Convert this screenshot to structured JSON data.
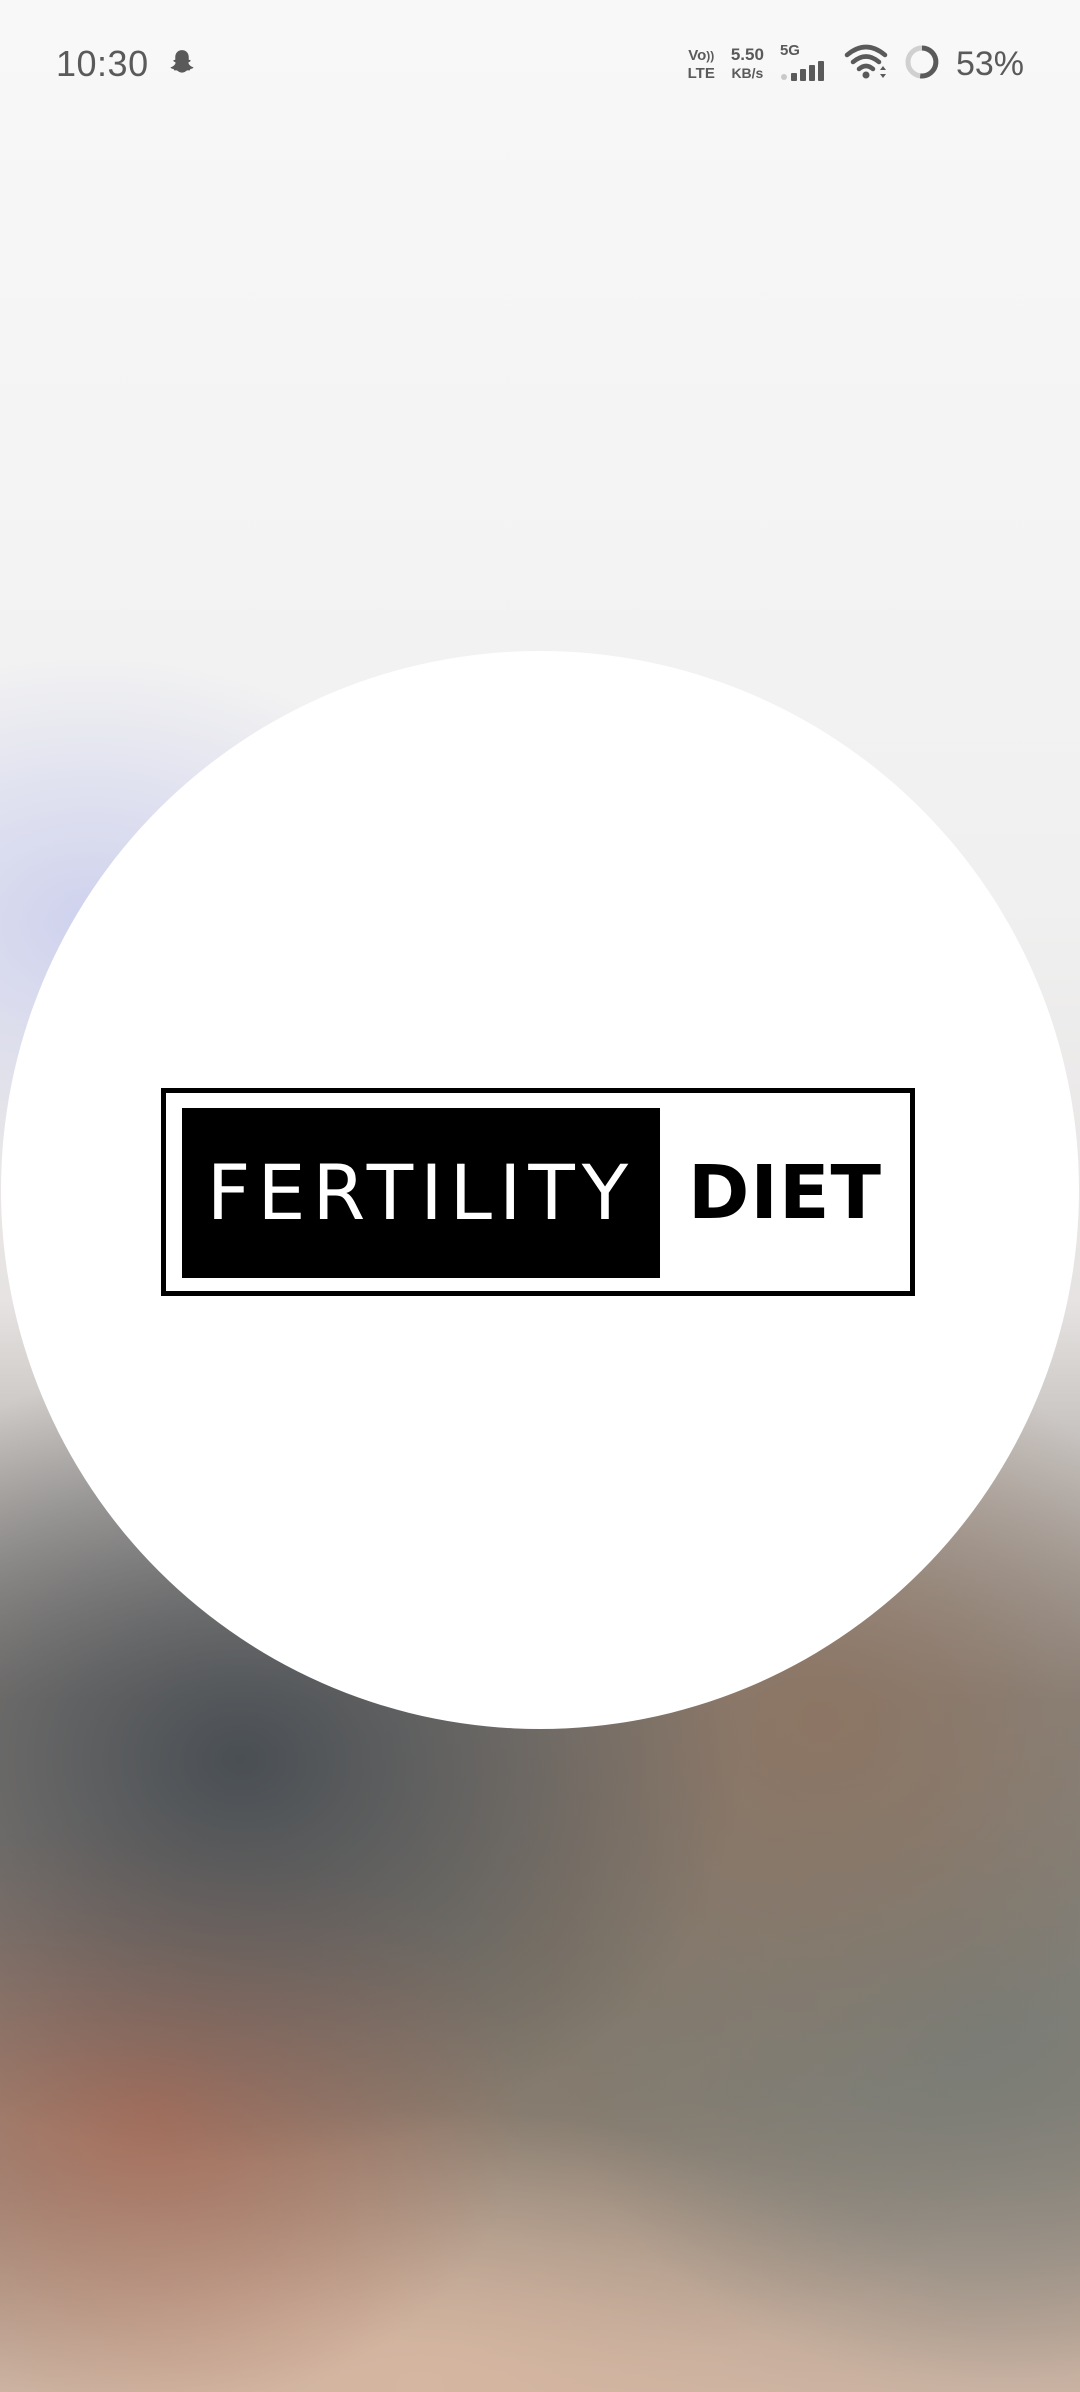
{
  "status_bar": {
    "time": "10:30",
    "volte_top": "Vo",
    "volte_bottom": "LTE",
    "net_speed_value": "5.50",
    "net_speed_unit": "KB/s",
    "network_type": "5G",
    "battery_percent": "53%",
    "icons": [
      "snapchat-ghost-icon",
      "signal-bars-icon",
      "wifi-icon",
      "battery-ring-icon"
    ]
  },
  "splash": {
    "logo_word_1": "FERTILITY",
    "logo_word_2": "DIET"
  }
}
